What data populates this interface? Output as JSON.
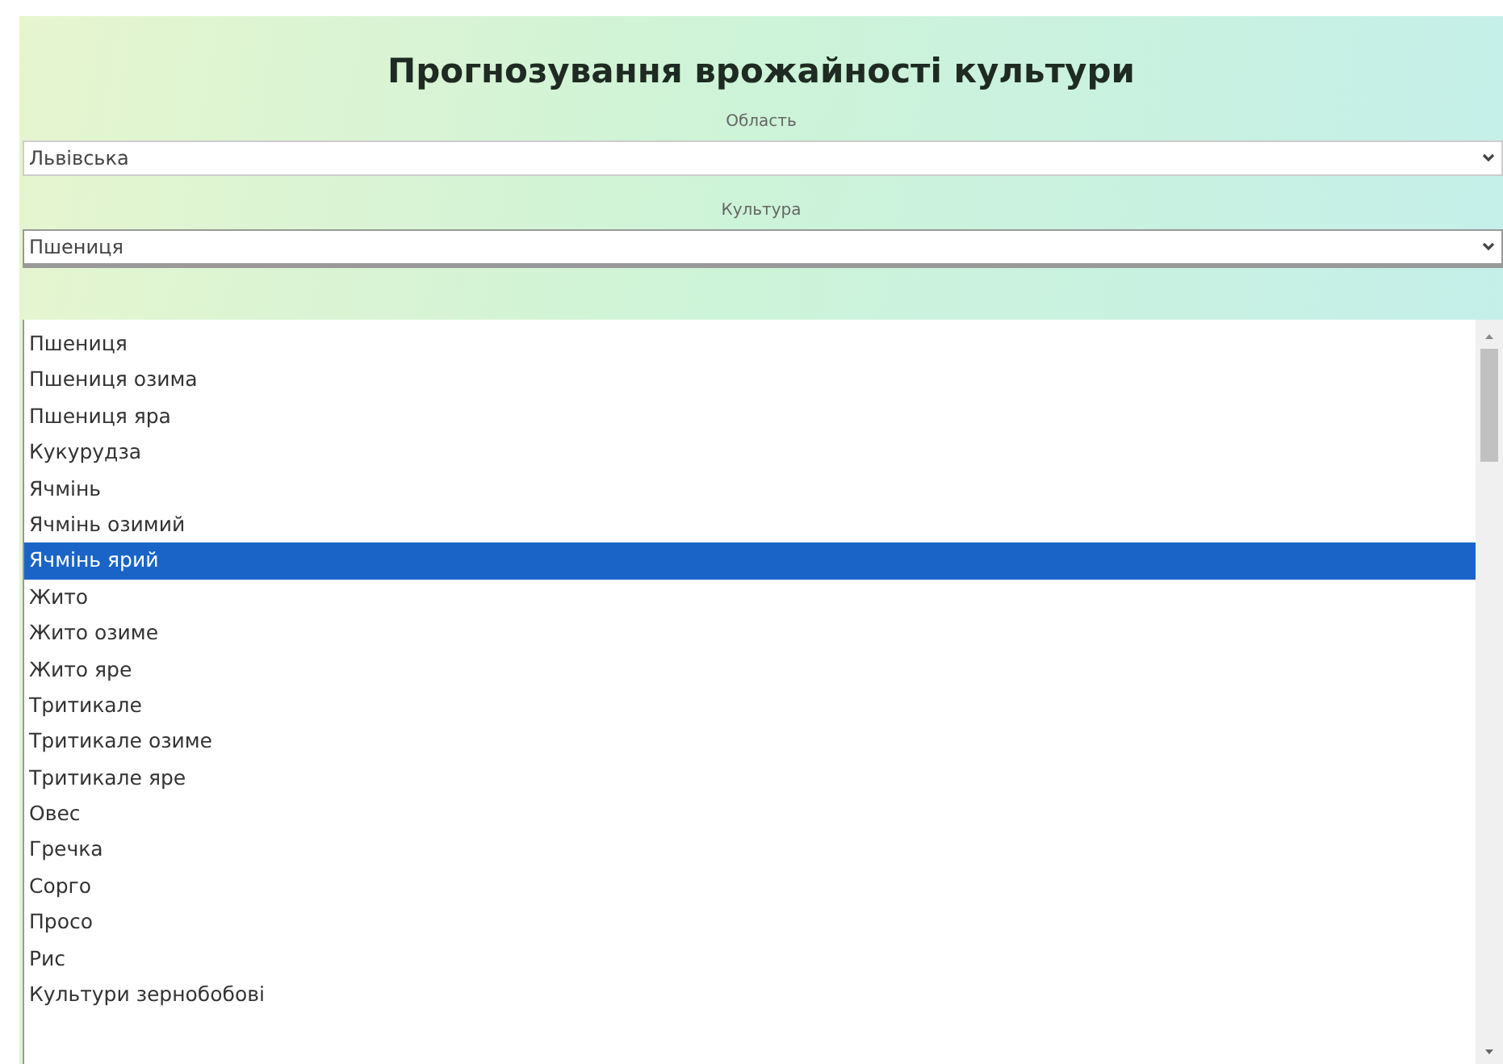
{
  "title": "Прогнозування врожайності культури",
  "fields": [
    {
      "label": "Область",
      "value": "Львівська"
    },
    {
      "label": "Культура",
      "value": "Пшениця",
      "expanded": true
    }
  ],
  "options": [
    {
      "label": "Пшениця",
      "selected": false
    },
    {
      "label": "Пшениця озима",
      "selected": false
    },
    {
      "label": "Пшениця яра",
      "selected": false
    },
    {
      "label": "Кукурудза",
      "selected": false
    },
    {
      "label": "Ячмінь",
      "selected": false
    },
    {
      "label": "Ячмінь озимий",
      "selected": false
    },
    {
      "label": "Ячмінь ярий",
      "selected": true
    },
    {
      "label": "Жито",
      "selected": false
    },
    {
      "label": "Жито озиме",
      "selected": false
    },
    {
      "label": "Жито яре",
      "selected": false
    },
    {
      "label": "Тритикале",
      "selected": false
    },
    {
      "label": "Тритикале озиме",
      "selected": false
    },
    {
      "label": "Тритикале яре",
      "selected": false
    },
    {
      "label": "Овес",
      "selected": false
    },
    {
      "label": "Гречка",
      "selected": false
    },
    {
      "label": "Сорго",
      "selected": false
    },
    {
      "label": "Просо",
      "selected": false
    },
    {
      "label": "Рис",
      "selected": false
    },
    {
      "label": "Культури зернобобові",
      "selected": false
    }
  ]
}
